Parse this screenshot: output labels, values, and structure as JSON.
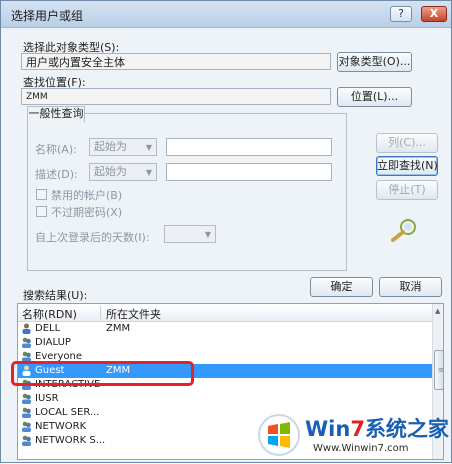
{
  "window": {
    "title": "选择用户或组",
    "help_label": "?",
    "close_label": "X"
  },
  "object_type": {
    "label": "选择此对象类型(S):",
    "value": "用户或内置安全主体",
    "button": "对象类型(O)..."
  },
  "location": {
    "label": "查找位置(F):",
    "value": "ZMM",
    "button": "位置(L)..."
  },
  "general_query": {
    "tab_label": "一般性查询",
    "name_label": "名称(A):",
    "name_combo": "起始为",
    "desc_label": "描述(D):",
    "desc_combo": "起始为",
    "disabled_accounts_label": "禁用的帐户(B)",
    "no_expire_label": "不过期密码(X)",
    "days_label": "自上次登录后的天数(I):"
  },
  "side_buttons": {
    "columns": "列(C)...",
    "find_now": "立即查找(N)",
    "stop": "停止(T)"
  },
  "actions": {
    "ok": "确定",
    "cancel": "取消"
  },
  "results": {
    "label": "搜索结果(U):",
    "columns": [
      "名称(RDN)",
      "所在文件夹"
    ],
    "rows": [
      {
        "name": "DELL",
        "folder": "ZMM"
      },
      {
        "name": "DIALUP",
        "folder": ""
      },
      {
        "name": "Everyone",
        "folder": ""
      },
      {
        "name": "Guest",
        "folder": "ZMM",
        "selected": true
      },
      {
        "name": "INTERACTIVE",
        "folder": ""
      },
      {
        "name": "IUSR",
        "folder": ""
      },
      {
        "name": "LOCAL SER...",
        "folder": ""
      },
      {
        "name": "NETWORK",
        "folder": ""
      },
      {
        "name": "NETWORK S...",
        "folder": ""
      }
    ]
  },
  "watermark": {
    "brand_w": "Win",
    "brand_7": "7",
    "brand_rest": "系统之家",
    "url": "Www.Winwin7.com"
  },
  "colors": {
    "selection": "#3399ff",
    "highlight_box": "#e8202a",
    "brand_blue": "#1b5fb2",
    "brand_red": "#e21f26"
  }
}
